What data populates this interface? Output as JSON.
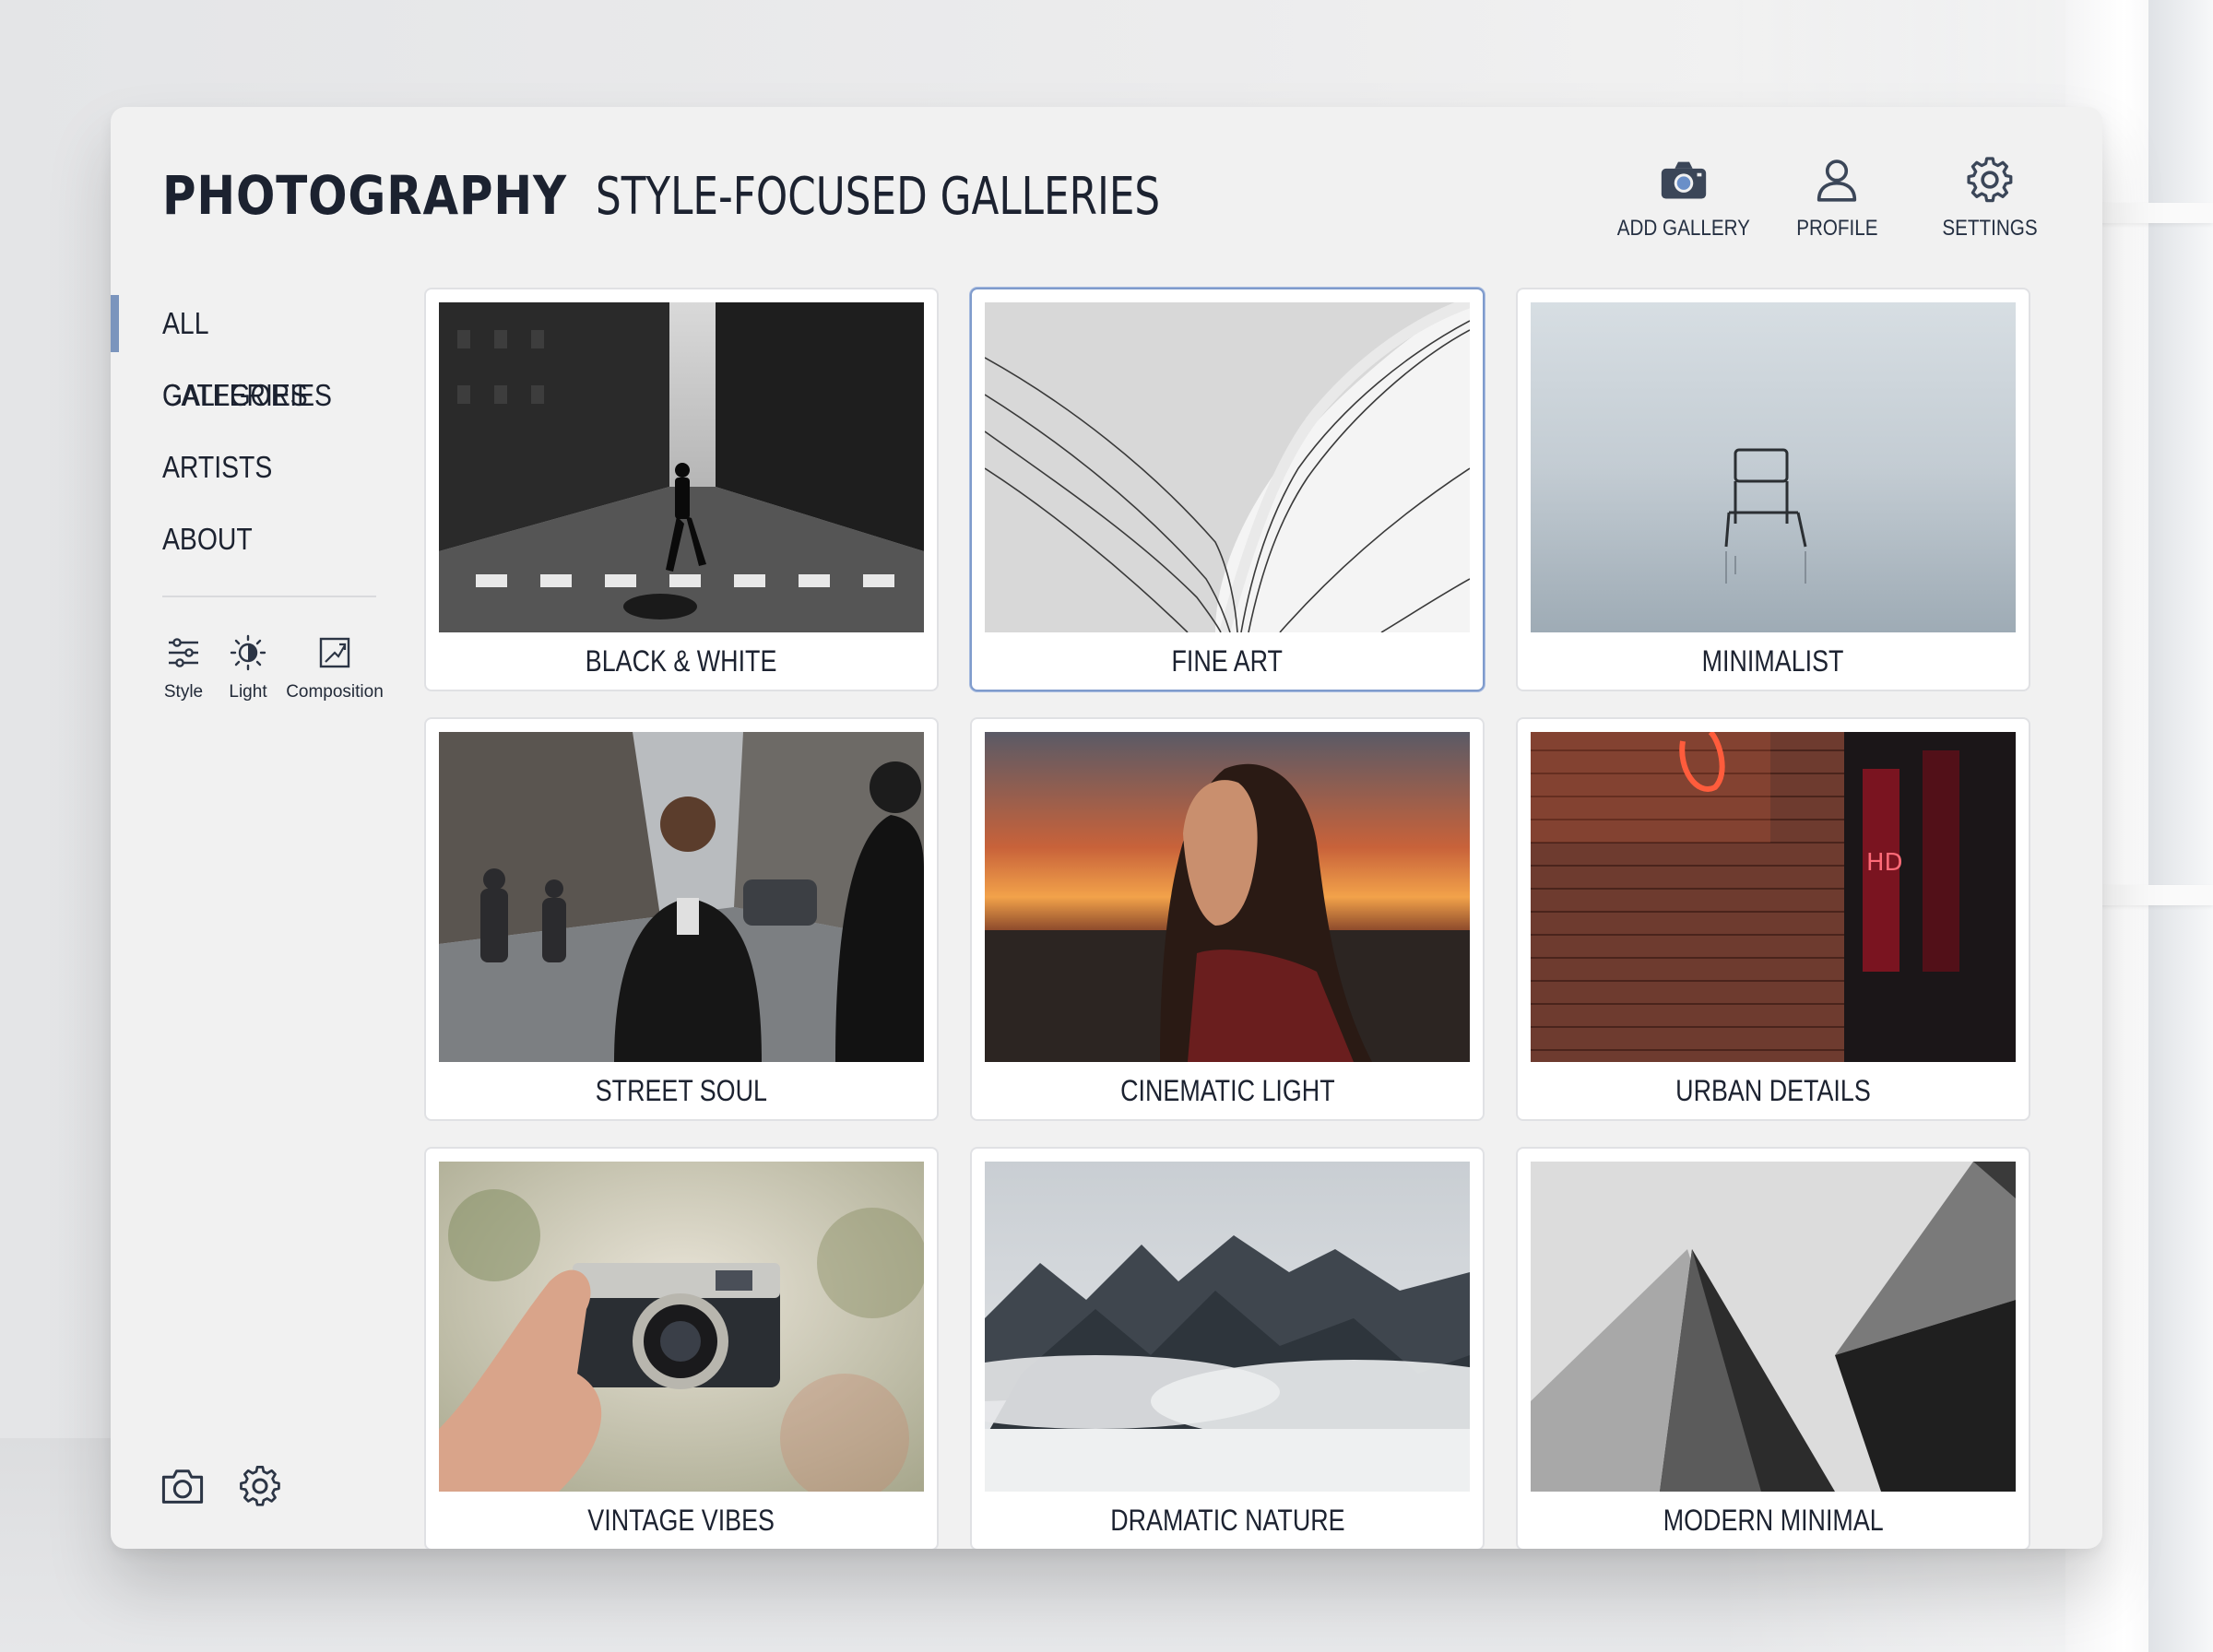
{
  "header": {
    "title": "PHOTOGRAPHY",
    "subtitle": "STYLE-FOCUSED GALLERIES"
  },
  "top_actions": [
    {
      "label": "ADD GALLERY",
      "icon": "camera-icon"
    },
    {
      "label": "PROFILE",
      "icon": "user-icon"
    },
    {
      "label": "SETTINGS",
      "icon": "gear-icon"
    }
  ],
  "sidebar": {
    "items": [
      {
        "label": "ALL GALLERIES",
        "active": true
      },
      {
        "label": "CATEGORIES",
        "active": false
      },
      {
        "label": "ARTISTS",
        "active": false
      },
      {
        "label": "ABOUT",
        "active": false
      }
    ],
    "tools": [
      {
        "label": "Style",
        "icon": "sliders-icon"
      },
      {
        "label": "Light",
        "icon": "contrast-icon"
      },
      {
        "label": "Composition",
        "icon": "crop-frame-icon"
      }
    ],
    "bottom_icons": [
      "camera-icon",
      "gear-icon"
    ]
  },
  "galleries": [
    {
      "title": "BLACK & WHITE",
      "selected": false
    },
    {
      "title": "FINE ART",
      "selected": true
    },
    {
      "title": "MINIMALIST",
      "selected": false
    },
    {
      "title": "STREET SOUL",
      "selected": false
    },
    {
      "title": "CINEMATIC LIGHT",
      "selected": false
    },
    {
      "title": "URBAN DETAILS",
      "selected": false
    },
    {
      "title": "VINTAGE VIBES",
      "selected": false
    },
    {
      "title": "DRAMATIC NATURE",
      "selected": false
    },
    {
      "title": "MODERN MINIMAL",
      "selected": false
    }
  ],
  "colors": {
    "accent": "#7b95bd",
    "selected_border": "#7f9bcc",
    "text": "#1c2230",
    "panel_bg": "#f1f1f1"
  }
}
